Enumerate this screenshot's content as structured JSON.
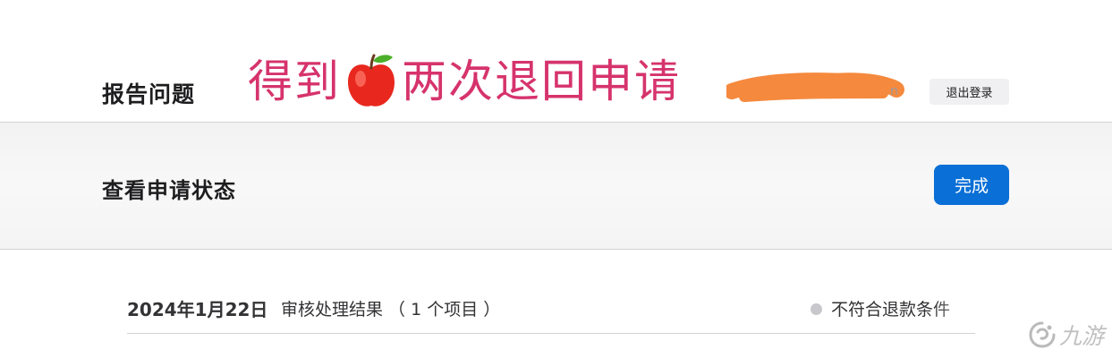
{
  "header": {
    "title": "报告问题",
    "signout_label": "退出登录"
  },
  "overlay": {
    "caption_before": "得到",
    "caption_icon": "red-apple-emoji-icon",
    "caption_after": "两次退回申请",
    "color": "#d6336c",
    "redaction_color": "#f5893d"
  },
  "status_section": {
    "title": "查看申请状态",
    "done_label": "完成",
    "accent": "#0a6fd6"
  },
  "report": {
    "date": "2024年1月22日",
    "summary": "审核处理结果 （ 1 个项目 ）",
    "status": "不符合退款条件"
  },
  "watermark": {
    "icon": "nine-game-logo-icon",
    "text": "九游"
  }
}
